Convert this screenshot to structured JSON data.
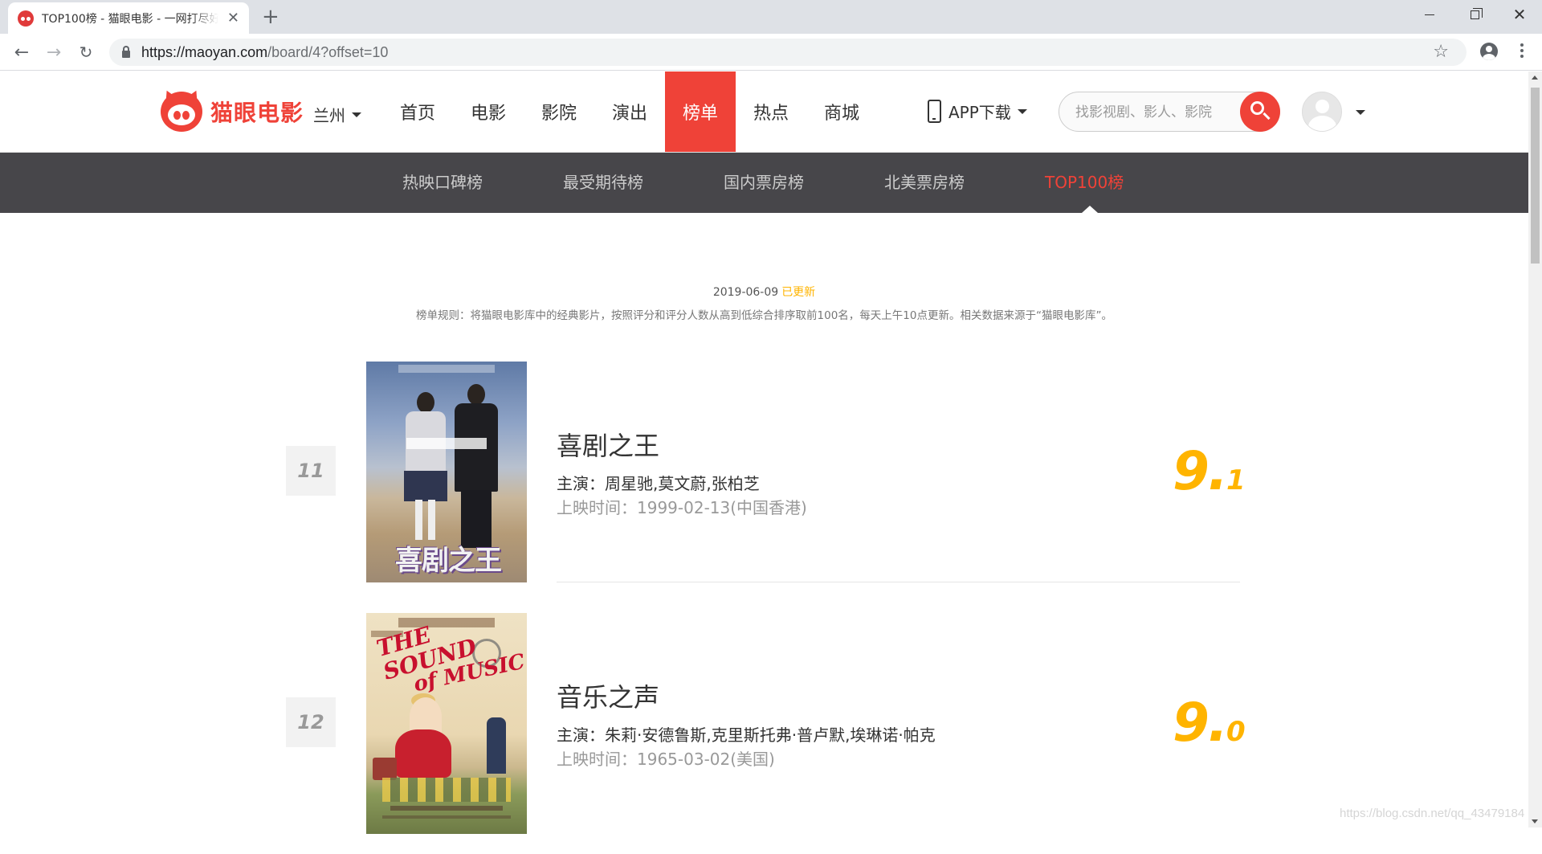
{
  "browser": {
    "tab_title": "TOP100榜 - 猫眼电影 - 一网打尽好电影",
    "url_host": "https://maoyan.com",
    "url_path": "/board/4?offset=10"
  },
  "header": {
    "logo_text": "猫眼电影",
    "city": "兰州",
    "nav": [
      "首页",
      "电影",
      "影院",
      "演出",
      "榜单",
      "热点",
      "商城"
    ],
    "active_nav": "榜单",
    "app_download": "APP下载",
    "search_placeholder": "找影视剧、影人、影院"
  },
  "subnav": {
    "items": [
      "热映口碑榜",
      "最受期待榜",
      "国内票房榜",
      "北美票房榜",
      "TOP100榜"
    ],
    "active": "TOP100榜"
  },
  "board": {
    "date": "2019-06-09",
    "updated": "已更新",
    "rules": "榜单规则：将猫眼电影库中的经典影片，按照评分和评分人数从高到低综合排序取前100名，每天上午10点更新。相关数据来源于“猫眼电影库”。"
  },
  "movies": [
    {
      "rank": "11",
      "title": "喜剧之王",
      "stars": "主演：周星驰,莫文蔚,张柏芝",
      "release": "上映时间：1999-02-13(中国香港)",
      "score_int": "9.",
      "score_frac": "1",
      "poster_title": "喜剧之王"
    },
    {
      "rank": "12",
      "title": "音乐之声",
      "stars": "主演：朱莉·安德鲁斯,克里斯托弗·普卢默,埃琳诺·帕克",
      "release": "上映时间：1965-03-02(美国)",
      "score_int": "9.",
      "score_frac": "0",
      "poster_title_1": "THE SOUND",
      "poster_title_2": "of MUSIC"
    }
  ],
  "watermark": "https://blog.csdn.net/qq_43479184",
  "colors": {
    "brand": "#ef4238",
    "score": "#ffb400",
    "subnav_bg": "#47464a"
  }
}
